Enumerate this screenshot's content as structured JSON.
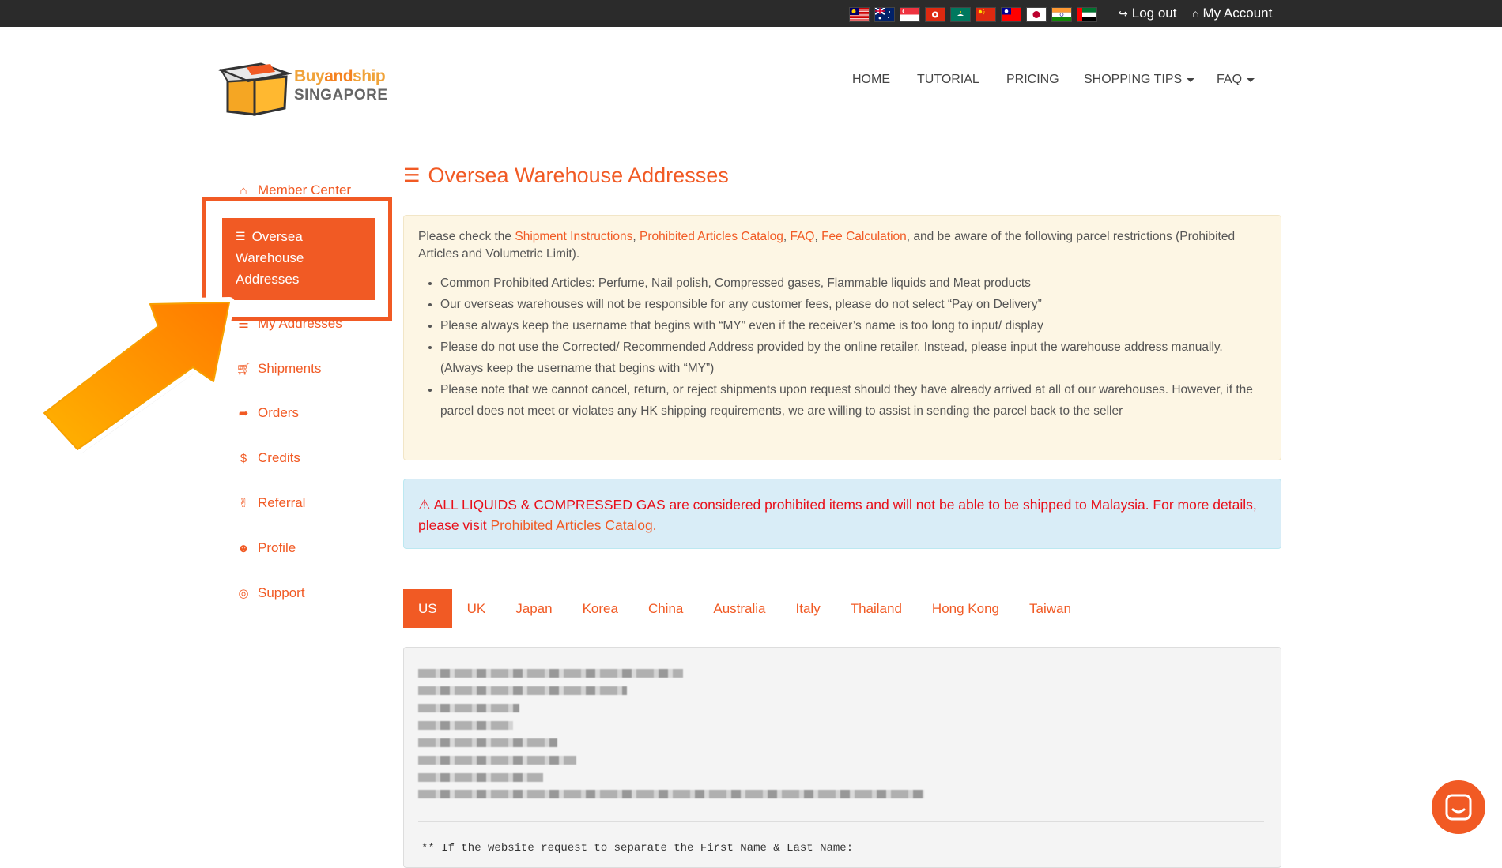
{
  "topbar": {
    "flags": [
      {
        "name": "malaysia-flag-icon",
        "colors": [
          "#cc0001",
          "#ffffff",
          "#010066",
          "#ffcc00"
        ]
      },
      {
        "name": "australia-flag-icon",
        "colors": [
          "#012169",
          "#ffffff",
          "#e4002b"
        ]
      },
      {
        "name": "singapore-flag-icon",
        "colors": [
          "#ef3340",
          "#ffffff"
        ]
      },
      {
        "name": "hong-kong-flag-icon",
        "colors": [
          "#de2910",
          "#ffffff"
        ]
      },
      {
        "name": "macau-flag-icon",
        "colors": [
          "#00785e",
          "#ffffff",
          "#ffd700"
        ]
      },
      {
        "name": "china-flag-icon",
        "colors": [
          "#de2910",
          "#ffde00"
        ]
      },
      {
        "name": "taiwan-flag-icon",
        "colors": [
          "#fe0000",
          "#000095",
          "#ffffff"
        ]
      },
      {
        "name": "japan-flag-icon",
        "colors": [
          "#ffffff",
          "#bc002d"
        ]
      },
      {
        "name": "india-flag-icon",
        "colors": [
          "#ff9933",
          "#ffffff",
          "#138808"
        ]
      },
      {
        "name": "uae-flag-icon",
        "colors": [
          "#00732f",
          "#ffffff",
          "#000000",
          "#ff0000"
        ]
      }
    ],
    "logout_label": "Log out",
    "account_label": "My Account"
  },
  "logo": {
    "line1_a": "Buy",
    "line1_b": "and",
    "line1_c": "ship",
    "line2": "SINGAPORE"
  },
  "nav": {
    "home": "HOME",
    "tutorial": "TUTORIAL",
    "pricing": "PRICING",
    "shopping_tips": "SHOPPING TIPS",
    "faq": "FAQ"
  },
  "sidebar": {
    "member_center": "Member Center",
    "active": "Oversea Warehouse Addresses",
    "active_lines": [
      "Oversea",
      "Warehouse",
      "Addresses"
    ],
    "my_addresses": "My Addresses",
    "shipments": "Shipments",
    "orders": "Orders",
    "credits": "Credits",
    "referral": "Referral",
    "profile": "Profile",
    "support": "Support"
  },
  "main": {
    "title": "Oversea Warehouse Addresses",
    "notice": {
      "intro_prefix": "Please check the ",
      "link_instructions": "Shipment Instructions",
      "link_catalog": "Prohibited Articles Catalog",
      "link_faq": "FAQ",
      "link_fee": "Fee Calculation",
      "intro_suffix": ", and be aware of the following parcel restrictions (Prohibited Articles and Volumetric Limit).",
      "bullets": [
        "Common Prohibited Articles: Perfume, Nail polish, Compressed gases, Flammable liquids and Meat products",
        "Our overseas warehouses will not be responsible for any customer fees, please do not select “Pay on Delivery”",
        "Please always keep the username that begins with “MY” even if the receiver’s name is too long to input/ display",
        "Please do not use the Corrected/ Recommended Address provided by the online retailer. Instead, please input the warehouse address manually. (Always keep the username that begins with “MY”)",
        "Please note that we cannot cancel, return, or reject shipments upon request should they have already arrived at all of our warehouses. However, if the parcel does not meet or violates any HK shipping requirements, we are willing to assist in sending the parcel back to the seller"
      ]
    },
    "alert": {
      "text": "ALL LIQUIDS & COMPRESSED GAS are considered prohibited items and will not be able to be shipped to Malaysia. For more details, please visit ",
      "link": "Prohibited Articles Catalog."
    },
    "tabs": [
      "US",
      "UK",
      "Japan",
      "Korea",
      "China",
      "Australia",
      "Italy",
      "Thailand",
      "Hong Kong",
      "Taiwan"
    ],
    "active_tab": "US",
    "address_note": "** If the website request to separate the First Name & Last Name:"
  },
  "colors": {
    "accent": "#f15a24",
    "topbar": "#2b2b2b",
    "notice_bg": "#fdf6e4",
    "alert_bg": "#d9edf7",
    "alert_text": "#e8101a"
  }
}
